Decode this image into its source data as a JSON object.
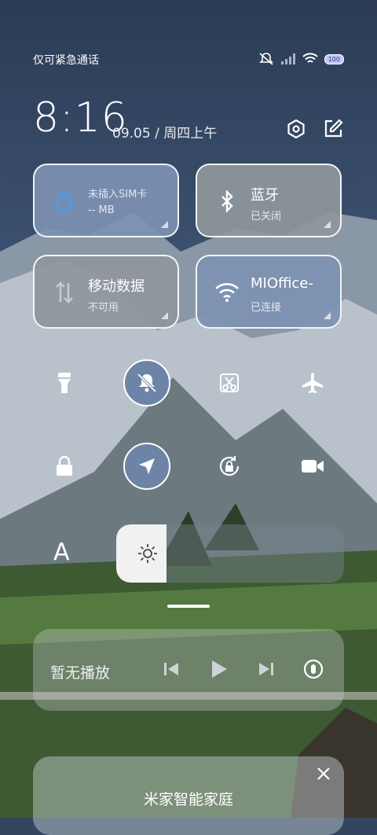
{
  "status_bar": {
    "carrier": "仅可紧急通话",
    "battery": "100"
  },
  "header": {
    "time": "8:16",
    "date": "09.05 / 周四上午"
  },
  "tiles": [
    {
      "title": "未插入SIM卡",
      "sub": "-- MB"
    },
    {
      "title": "蓝牙",
      "sub": "已关闭"
    },
    {
      "title": "移动数据",
      "sub": "不可用"
    },
    {
      "title": "MIOffice-",
      "sub": "已连接"
    }
  ],
  "brightness": {
    "auto_label": "A",
    "level": 0.22
  },
  "media": {
    "label": "暂无播放"
  },
  "card": {
    "title": "米家智能家庭"
  },
  "icons": {
    "settings": "settings-icon",
    "edit": "edit-icon",
    "droplet": "data-usage-icon",
    "bluetooth": "bluetooth-icon",
    "updown": "mobile-data-icon",
    "wifi": "wifi-icon",
    "flashlight": "flashlight-icon",
    "mute": "silent-mode-icon",
    "screenshot": "screenshot-icon",
    "airplane": "airplane-mode-icon",
    "lock": "lock-screen-icon",
    "location": "location-icon",
    "rotation": "rotation-lock-icon",
    "video": "screen-record-icon"
  },
  "colors": {
    "active_tile": "#7d91b2",
    "inactive_tile": "#8f969c",
    "active_button": "#6d84a6"
  }
}
